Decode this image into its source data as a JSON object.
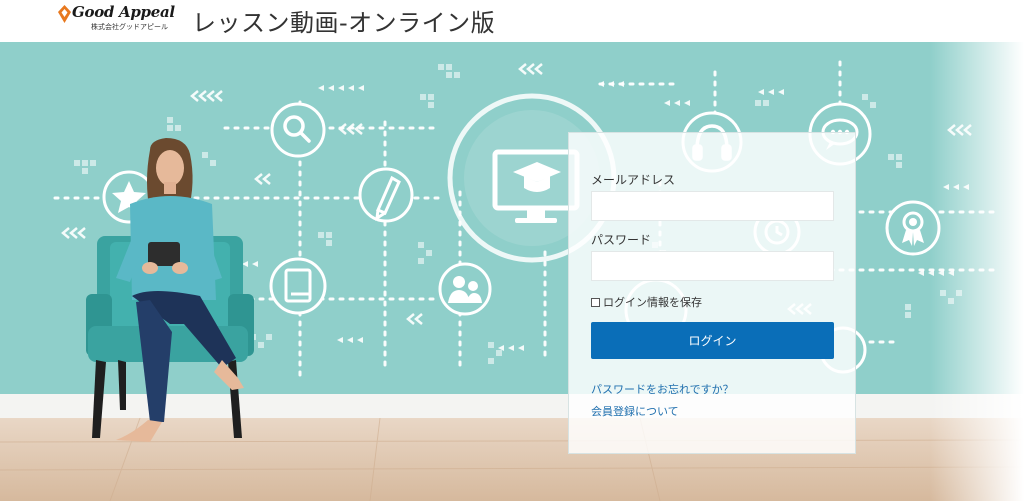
{
  "header": {
    "logo_text": "Good Appeal",
    "logo_subtext": "株式会社グッドアピール",
    "site_title": "レッスン動画-オンライン版"
  },
  "colors": {
    "hero_bg": "#8fcfca",
    "button": "#0a6eb8",
    "link": "#1f6fae",
    "logo_accent": "#e8781e"
  },
  "hero": {
    "icons": [
      "search-icon",
      "star-icon",
      "pencil-icon",
      "book-icon",
      "graduation-monitor-icon",
      "users-icon",
      "headphones-icon",
      "chat-icon",
      "award-icon",
      "clock-icon"
    ]
  },
  "login": {
    "email_label": "メールアドレス",
    "email_value": "",
    "password_label": "パスワード",
    "password_value": "",
    "remember_label": "ログイン情報を保存",
    "remember_checked": false,
    "login_button": "ログイン",
    "forgot_password_link": "パスワードをお忘れですか？",
    "register_link": "会員登録について"
  }
}
